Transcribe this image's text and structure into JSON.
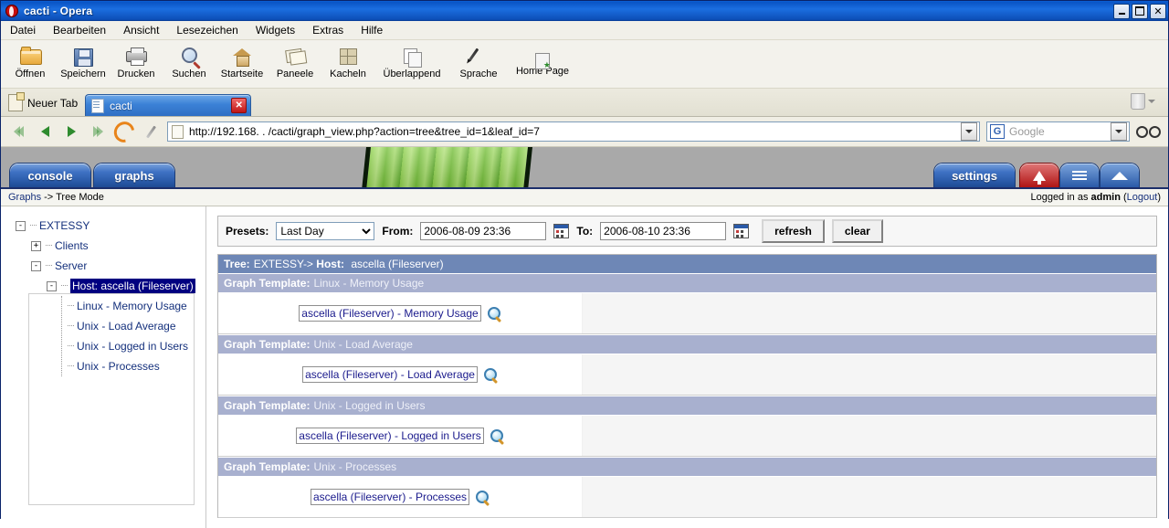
{
  "window": {
    "title": "cacti - Opera",
    "app_icon": "opera-logo-icon",
    "controls": {
      "minimize": "minimize-icon",
      "restore": "restore-icon",
      "close": "close-icon"
    }
  },
  "menubar": {
    "items": [
      "Datei",
      "Bearbeiten",
      "Ansicht",
      "Lesezeichen",
      "Widgets",
      "Extras",
      "Hilfe"
    ]
  },
  "toolbar": {
    "buttons": [
      {
        "label": "Öffnen",
        "icon": "folder-open-icon"
      },
      {
        "label": "Speichern",
        "icon": "floppy-disk-icon"
      },
      {
        "label": "Drucken",
        "icon": "printer-icon"
      },
      {
        "label": "Suchen",
        "icon": "magnifier-icon"
      },
      {
        "label": "Startseite",
        "icon": "home-icon"
      },
      {
        "label": "Paneele",
        "icon": "panels-icon"
      },
      {
        "label": "Kacheln",
        "icon": "tile-windows-icon"
      },
      {
        "label": "Überlappend",
        "icon": "cascade-windows-icon"
      },
      {
        "label": "Sprache",
        "icon": "pen-icon"
      },
      {
        "label": "Home Page",
        "icon": "home-page-icon"
      }
    ]
  },
  "tabbar": {
    "new_tab_label": "Neuer Tab",
    "active_tab": {
      "label": "cacti",
      "close_label": "✕"
    },
    "trash_icon": "trash-can-icon"
  },
  "addressbar": {
    "url": "http://192.168.    .    /cacti/graph_view.php?action=tree&tree_id=1&leaf_id=7",
    "search_placeholder": "Google",
    "search_engine_initial": "G"
  },
  "cacti_header": {
    "tabs": [
      "console",
      "graphs"
    ],
    "settings_label": "settings",
    "mode_buttons": [
      "tree-mode-icon",
      "list-mode-icon",
      "preview-mode-icon"
    ]
  },
  "crumbbar": {
    "breadcrumb_link": "Graphs",
    "breadcrumb_sep": "->",
    "breadcrumb_current": "Tree Mode",
    "login_prefix": "Logged in as",
    "login_user": "admin",
    "logout_open": "(",
    "logout_label": "Logout",
    "logout_close": ")"
  },
  "sidebar": {
    "tree": [
      {
        "label": "EXTESSY",
        "toggle": "-",
        "depth": 0,
        "selected": false
      },
      {
        "label": "Clients",
        "toggle": "+",
        "depth": 1,
        "selected": false
      },
      {
        "label": "Server",
        "toggle": "-",
        "depth": 1,
        "selected": false
      },
      {
        "label": "Host: ascella (Fileserver)",
        "toggle": "-",
        "depth": 2,
        "selected": true
      },
      {
        "label": "Linux - Memory Usage",
        "toggle": "",
        "depth": 3,
        "selected": false
      },
      {
        "label": "Unix - Load Average",
        "toggle": "",
        "depth": 3,
        "selected": false
      },
      {
        "label": "Unix - Logged in Users",
        "toggle": "",
        "depth": 3,
        "selected": false
      },
      {
        "label": "Unix - Processes",
        "toggle": "",
        "depth": 3,
        "selected": false
      }
    ]
  },
  "filter": {
    "presets_label": "Presets:",
    "presets_value": "Last Day",
    "presets_options": [
      "Last Day"
    ],
    "from_label": "From:",
    "from_value": "2006-08-09 23:36",
    "to_label": "To:",
    "to_value": "2006-08-10 23:36",
    "calendar_icon": "calendar-icon",
    "refresh_label": "refresh",
    "clear_label": "clear"
  },
  "graphs": {
    "tree_bar": {
      "prefix": "Tree:",
      "path": "EXTESSY->",
      "host_prefix": "Host:",
      "host": "ascella (Fileserver)"
    },
    "template_label": "Graph Template:",
    "sections": [
      {
        "template": "Linux - Memory Usage",
        "graph_alt": "ascella (Fileserver) - Memory Usage",
        "zoom_icon": "magnifier-icon"
      },
      {
        "template": "Unix - Load Average",
        "graph_alt": "ascella (Fileserver) - Load Average",
        "zoom_icon": "magnifier-icon"
      },
      {
        "template": "Unix - Logged in Users",
        "graph_alt": "ascella (Fileserver) - Logged in Users",
        "zoom_icon": "magnifier-icon"
      },
      {
        "template": "Unix - Processes",
        "graph_alt": "ascella (Fileserver) - Processes",
        "zoom_icon": "magnifier-icon"
      }
    ]
  }
}
